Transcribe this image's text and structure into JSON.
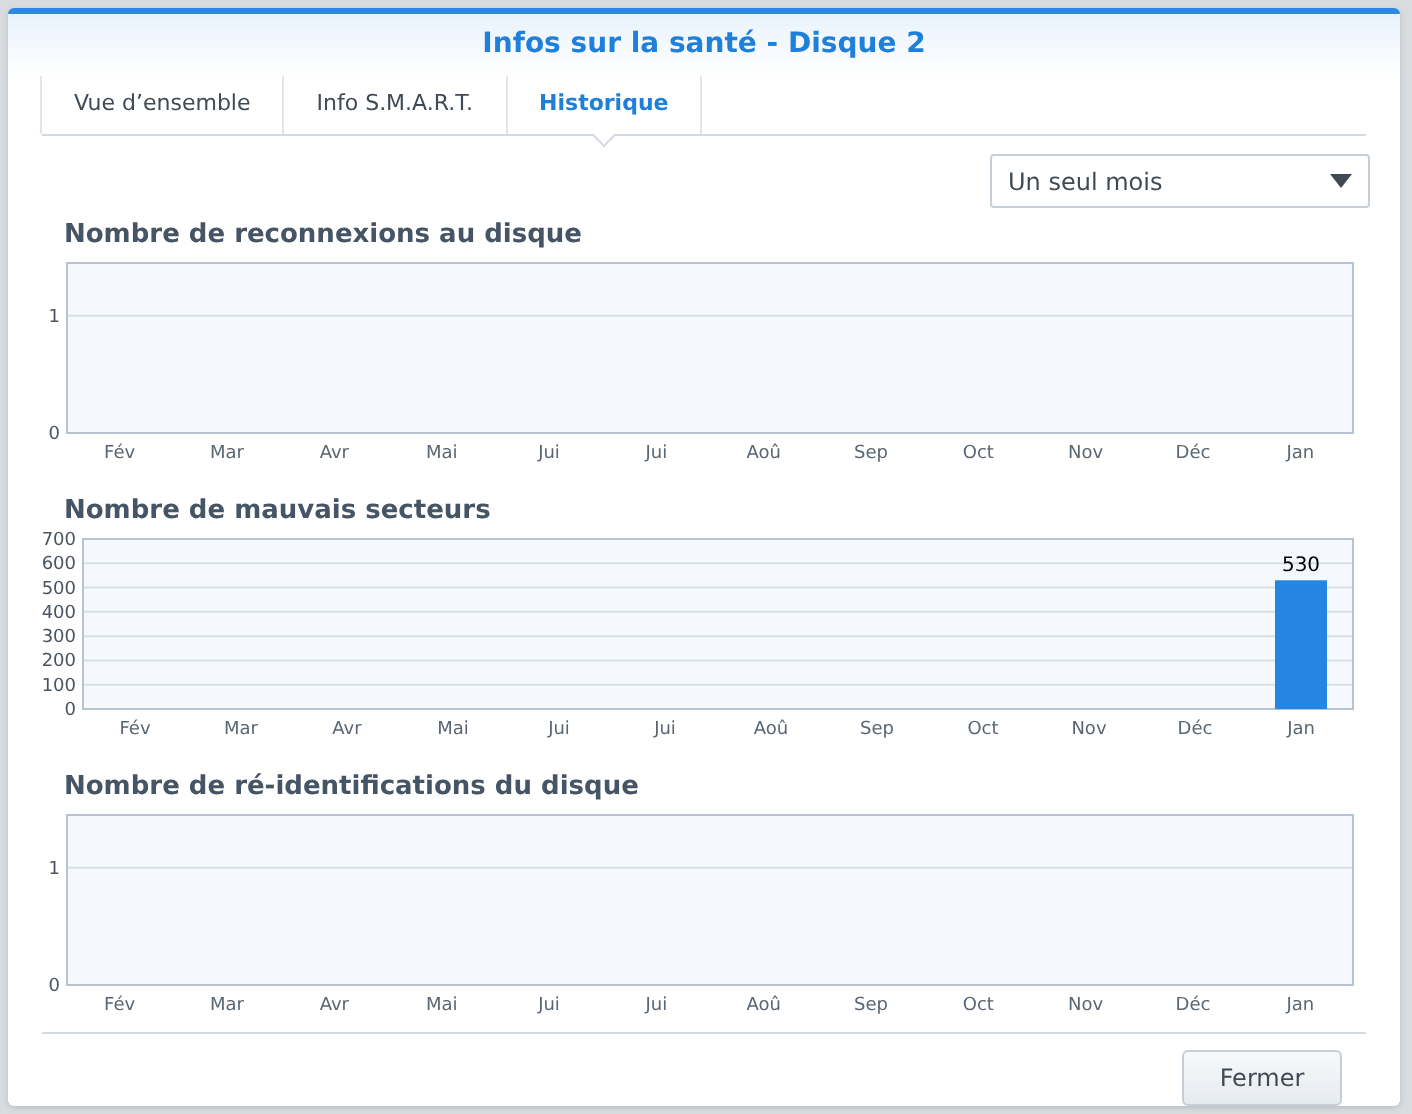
{
  "dialog": {
    "title": "Infos sur la santé - Disque 2"
  },
  "tabs": [
    {
      "label": "Vue d’ensemble",
      "selected": false
    },
    {
      "label": "Info S.M.A.R.T.",
      "selected": false
    },
    {
      "label": "Historique",
      "selected": true
    }
  ],
  "period_select": {
    "value": "Un seul mois"
  },
  "charts": [
    {
      "chart_data": {
        "type": "bar",
        "title": "Nombre de reconnexions au disque",
        "categories": [
          "Fév",
          "Mar",
          "Avr",
          "Mai",
          "Jui",
          "Jui",
          "Aoû",
          "Sep",
          "Oct",
          "Nov",
          "Déc",
          "Jan"
        ],
        "values": [
          0,
          0,
          0,
          0,
          0,
          0,
          0,
          0,
          0,
          0,
          0,
          0
        ],
        "ylim": [
          0,
          1.45
        ],
        "yticks": [
          0,
          1
        ],
        "grid": true
      }
    },
    {
      "chart_data": {
        "type": "bar",
        "title": "Nombre de mauvais secteurs",
        "categories": [
          "Fév",
          "Mar",
          "Avr",
          "Mai",
          "Jui",
          "Jui",
          "Aoû",
          "Sep",
          "Oct",
          "Nov",
          "Déc",
          "Jan"
        ],
        "values": [
          0,
          0,
          0,
          0,
          0,
          0,
          0,
          0,
          0,
          0,
          0,
          530
        ],
        "ylim": [
          0,
          700
        ],
        "yticks": [
          0,
          100,
          200,
          300,
          400,
          500,
          600,
          700
        ],
        "grid": true,
        "value_labels": [
          null,
          null,
          null,
          null,
          null,
          null,
          null,
          null,
          null,
          null,
          null,
          "530"
        ]
      }
    },
    {
      "chart_data": {
        "type": "bar",
        "title": "Nombre de ré-identifications du disque",
        "categories": [
          "Fév",
          "Mar",
          "Avr",
          "Mai",
          "Jui",
          "Jui",
          "Aoû",
          "Sep",
          "Oct",
          "Nov",
          "Déc",
          "Jan"
        ],
        "values": [
          0,
          0,
          0,
          0,
          0,
          0,
          0,
          0,
          0,
          0,
          0,
          0
        ],
        "ylim": [
          0,
          1.45
        ],
        "yticks": [
          0,
          1
        ],
        "grid": true
      }
    }
  ],
  "buttons": [
    {
      "label": "Fermer"
    }
  ]
}
